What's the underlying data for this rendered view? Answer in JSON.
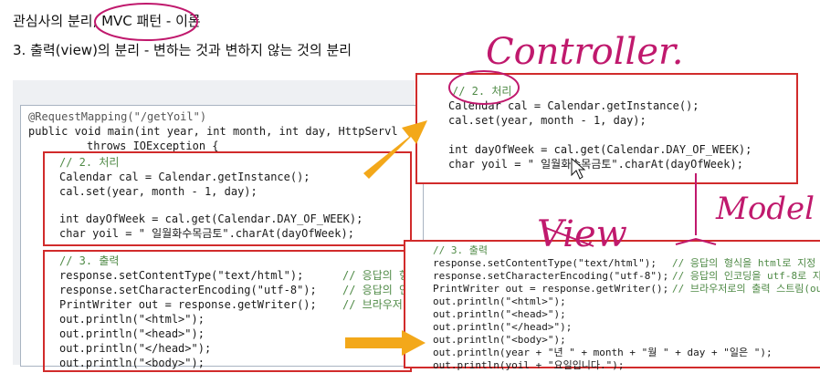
{
  "slide": {
    "title1": "관심사의 분리, MVC 패턴 - 이론",
    "title2": "3. 출력(view)의 분리 - 변하는 것과 변하지 않는 것의 분리"
  },
  "main_code": {
    "annotation": "@RequestMapping(\"/getYoil\")",
    "signature": "public void main(int year, int month, int day, HttpServl",
    "throws": "throws IOException {",
    "processing": {
      "comment": "// 2. 처리",
      "l1": "Calendar cal = Calendar.getInstance();",
      "l2": "cal.set(year, month - 1, day);",
      "l3": "int dayOfWeek = cal.get(Calendar.DAY_OF_WEEK);",
      "l4": "char yoil = \" 일월화수목금토\".charAt(dayOfWeek);"
    },
    "output": {
      "comment": "// 3. 출력",
      "l1": "response.setContentType(\"text/html\");",
      "l1c": "// 응답의 형",
      "l2": "response.setCharacterEncoding(\"utf-8\");",
      "l2c": "// 응답의 인",
      "l3": "PrintWriter out = response.getWriter();",
      "l3c": "// 브라우저",
      "l4": "out.println(\"<html>\");",
      "l5": "out.println(\"<head>\");",
      "l6": "out.println(\"</head>\");",
      "l7": "out.println(\"<body>\");"
    }
  },
  "controller_code": {
    "comment": "// 2. 처리",
    "l1": "Calendar cal = Calendar.getInstance();",
    "l2": "cal.set(year, month - 1, day);",
    "l3": "int dayOfWeek = cal.get(Calendar.DAY_OF_WEEK);",
    "l4": "char yoil = \" 일월화수목금토\".charAt(dayOfWeek);"
  },
  "view_code": {
    "comment": "// 3. 출력",
    "l1": "response.setContentType(\"text/html\");",
    "l1c": "// 응답의 형식을 html로 지정",
    "l2": "response.setCharacterEncoding(\"utf-8\");",
    "l2c": "// 응답의 인코딩을 utf-8로 지",
    "l3": "PrintWriter out = response.getWriter();",
    "l3c": "// 브라우저로의 출력 스트림(out",
    "l4": "out.println(\"<html>\");",
    "l5": "out.println(\"<head>\");",
    "l6": "out.println(\"</head>\");",
    "l7": "out.println(\"<body>\");",
    "l8": "out.println(year + \"년 \" + month + \"월 \" + day + \"일은 \");",
    "l9": "out.println(yoil + \"요일입니다.\");"
  },
  "handwriting": {
    "controller": "Controller.",
    "view": "View",
    "model": "Model"
  },
  "colors": {
    "annotation_red": "#d12b2b",
    "ink_magenta": "#c0196d",
    "arrow_orange": "#f3a81a"
  },
  "icons": [
    "arrow-right-icon",
    "mouse-cursor-icon"
  ]
}
